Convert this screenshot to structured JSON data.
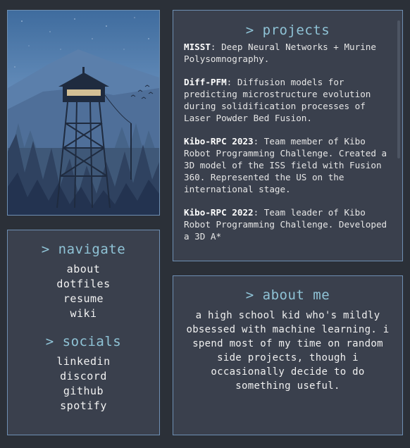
{
  "projects": {
    "heading": "> projects",
    "items": [
      {
        "name": "MISST",
        "desc": ": Deep Neural Networks + Murine Polysomnography."
      },
      {
        "name": "Diff-PFM",
        "desc": ": Diffusion models for predicting microstructure evolution during solidification processes of Laser Powder Bed Fusion."
      },
      {
        "name": "Kibo-RPC 2023",
        "desc": ": Team member of Kibo Robot Programming Challenge. Created a 3D model of the ISS field with Fusion 360. Represented the US on the international stage."
      },
      {
        "name": "Kibo-RPC 2022",
        "desc": ": Team leader of Kibo Robot Programming Challenge. Developed a 3D A*"
      }
    ]
  },
  "navigate": {
    "heading": "> navigate",
    "links": [
      "about",
      "dotfiles",
      "resume",
      "wiki"
    ]
  },
  "socials": {
    "heading": "> socials",
    "links": [
      "linkedin",
      "discord",
      "github",
      "spotify"
    ]
  },
  "about": {
    "heading": "> about me",
    "text": "a high school kid who's mildly obsessed with machine learning. i spend most of my time on random side projects, though i occasionally decide to do something useful."
  },
  "colors": {
    "background": "#2b3038",
    "panel": "#3a404d",
    "border": "#6e8fb3",
    "heading": "#8fc3d6"
  },
  "image": {
    "icon": "fire-lookout-tower-illustration"
  }
}
